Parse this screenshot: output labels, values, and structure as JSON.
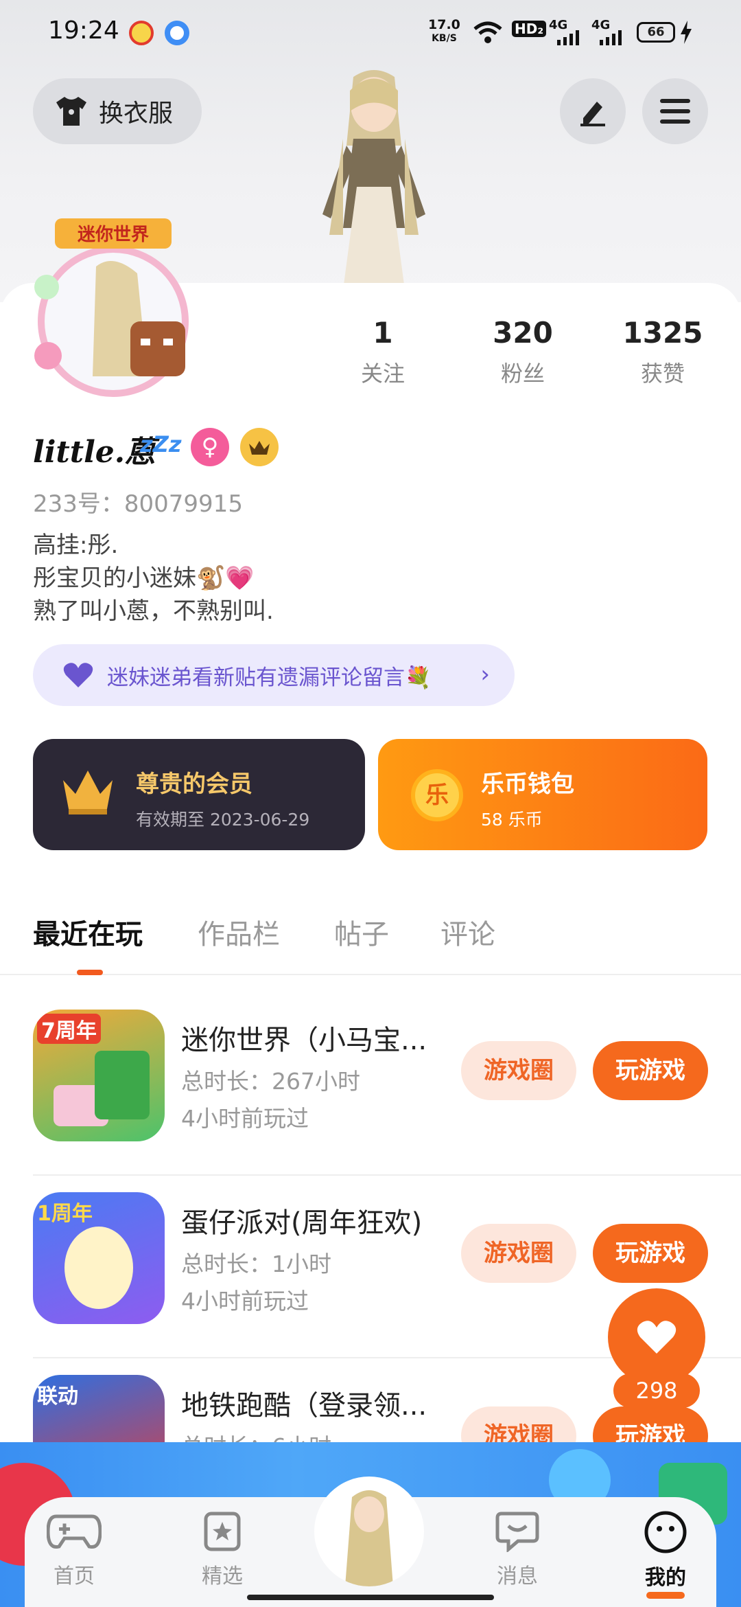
{
  "status_bar": {
    "time": "19:24",
    "net_speed_value": "17.0",
    "net_speed_unit": "KB/S",
    "hd_badge": "HD₂",
    "signal_1": "4G",
    "signal_2": "4G",
    "battery": "66"
  },
  "header": {
    "outfit_button": "换衣服",
    "edit_icon": "edit-icon",
    "menu_icon": "menu-icon"
  },
  "stats": [
    {
      "value": "1",
      "label": "关注"
    },
    {
      "value": "320",
      "label": "粉丝"
    },
    {
      "value": "1325",
      "label": "获赞"
    }
  ],
  "profile": {
    "username": "little.蒽",
    "zzz": "zZz",
    "gender_symbol": "♀",
    "uid": "233号：80079915",
    "bio": [
      "高挂:彤.",
      "彤宝贝的小迷妹🐒💗",
      "熟了叫小蒽，不熟别叫."
    ]
  },
  "notice": {
    "text": "迷妹迷弟看新贴有遗漏评论留言💐",
    "chevron": "›"
  },
  "vip_card": {
    "title": "尊贵的会员",
    "subtitle": "有效期至 2023-06-29"
  },
  "wallet_card": {
    "title": "乐币钱包",
    "subtitle": "58 乐币",
    "coin_char": "乐"
  },
  "tabs": [
    "最近在玩",
    "作品栏",
    "帖子",
    "评论"
  ],
  "games": [
    {
      "name": "迷你世界（小马宝...",
      "duration": "总时长：267小时",
      "last_played": "4小时前玩过",
      "circle_label": "游戏圈",
      "play_label": "玩游戏",
      "badge": "7周年"
    },
    {
      "name": "蛋仔派对(周年狂欢)",
      "duration": "总时长：1小时",
      "last_played": "4小时前玩过",
      "circle_label": "游戏圈",
      "play_label": "玩游戏",
      "badge": "1周年"
    },
    {
      "name": "地铁跑酷（登录领...",
      "duration": "总时长：6小时",
      "last_played": "",
      "circle_label": "游戏圈",
      "play_label": "玩游戏",
      "badge": "联动"
    }
  ],
  "like": {
    "count": "298"
  },
  "nav": [
    {
      "label": "首页",
      "icon": "gamepad-icon"
    },
    {
      "label": "精选",
      "icon": "star-bookmark-icon"
    },
    {
      "label": "消息",
      "icon": "chat-icon"
    },
    {
      "label": "我的",
      "icon": "smiley-icon"
    }
  ],
  "colors": {
    "accent": "#f5691d",
    "vip_bg": "#2c2836",
    "notice_text": "#6a55cf",
    "gender_pink": "#f45c9a"
  }
}
